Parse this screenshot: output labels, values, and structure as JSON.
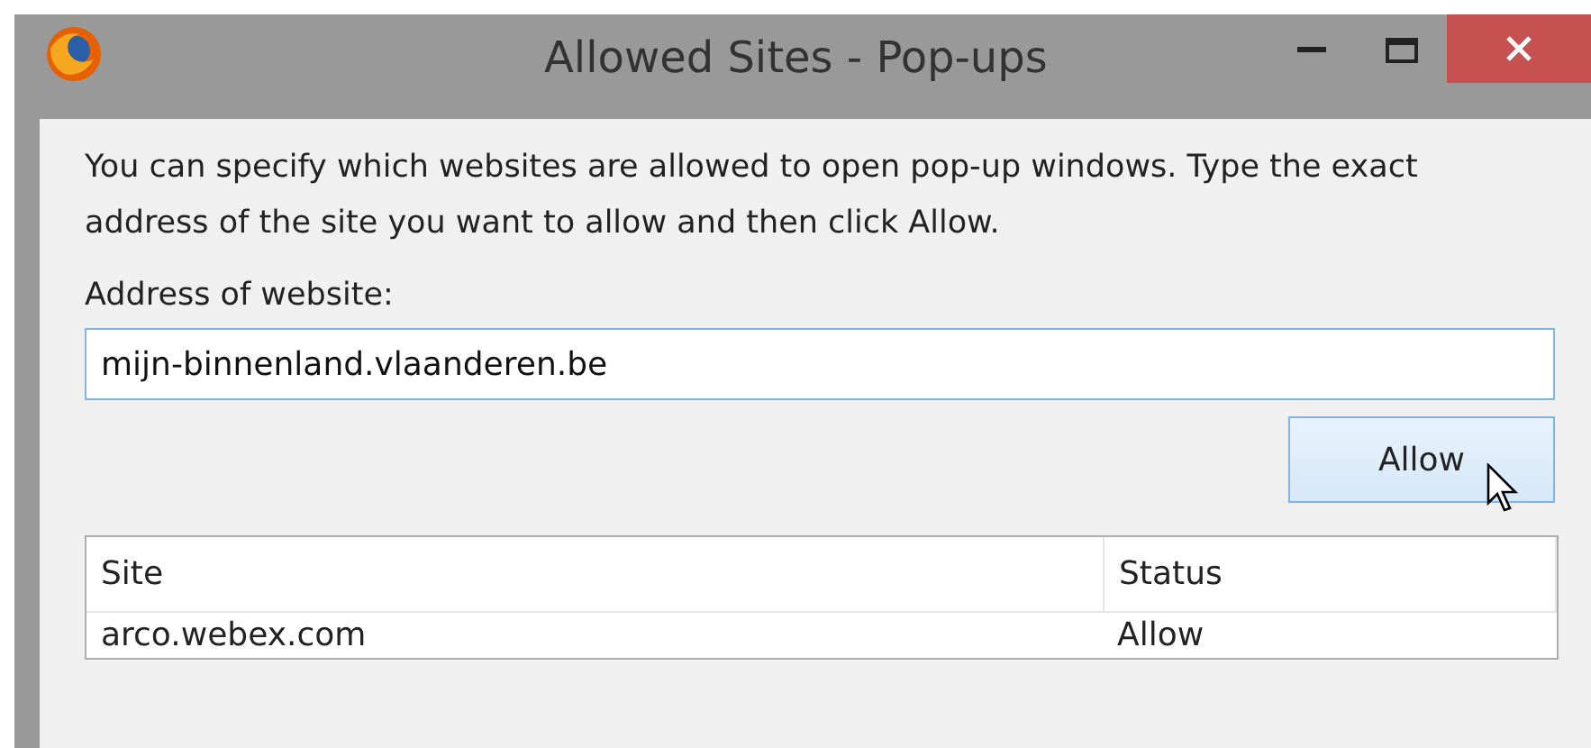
{
  "window": {
    "title": "Allowed Sites - Pop-ups"
  },
  "description": "You can specify which websites are allowed to open pop-up windows. Type the exact address of the site you want to allow and then click Allow.",
  "address": {
    "label": "Address of website:",
    "value": "mijn-binnenland.vlaanderen.be"
  },
  "allow_button": "Allow",
  "table": {
    "columns": [
      "Site",
      "Status"
    ],
    "rows": [
      {
        "site": "arco.webex.com",
        "status": "Allow"
      }
    ]
  }
}
